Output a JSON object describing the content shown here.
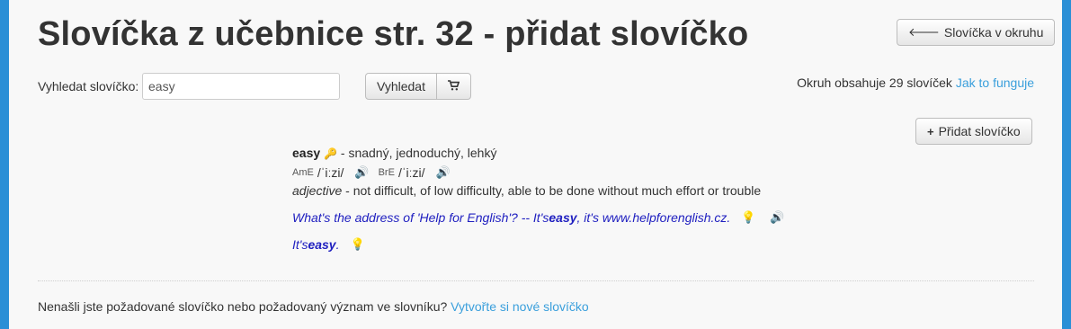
{
  "page_title": "Slovíčka z učebnice str. 32 - přidat slovíčko",
  "back_button": "Slovíčka v okruhu",
  "search": {
    "label": "Vyhledat slovíčko:",
    "value": "easy",
    "button": "Vyhledat"
  },
  "info": {
    "text": "Okruh obsahuje 29 slovíček",
    "link": "Jak to funguje"
  },
  "add_button": "Přidat slovíčko",
  "entry": {
    "word": "easy",
    "translation": " - snadný, jednoduchý, lehký",
    "ame_label": "AmE",
    "ame_ipa": "/ˈiːzi/",
    "bre_label": "BrE",
    "bre_ipa": "/ˈiːzi/",
    "pos": "adjective",
    "definition": " - not difficult, of low difficulty, able to be done without much effort or trouble",
    "example1_pre": "What's the address of 'Help for English'? -- It's ",
    "example1_bold": "easy",
    "example1_post": ", it's www.helpforenglish.cz.",
    "example2_pre": "It's ",
    "example2_bold": "easy",
    "example2_post": "."
  },
  "footer": {
    "text": "Nenašli jste požadované slovíčko nebo požadovaný význam ve slovníku?",
    "link": "Vytvořte si nové slovíčko"
  },
  "colors": {
    "background": "#2b8fd6",
    "link": "#3a9fdc",
    "example_text": "#2020c0"
  }
}
